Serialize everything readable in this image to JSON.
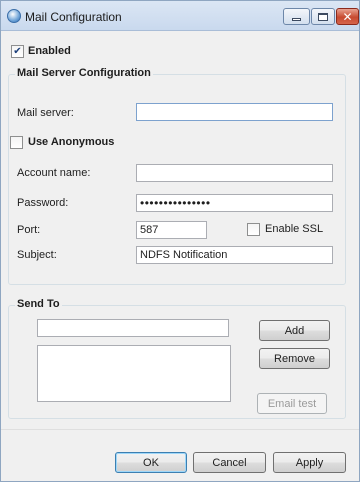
{
  "window": {
    "title": "Mail Configuration",
    "minimize_icon": "minimize-icon",
    "maximize_icon": "maximize-icon",
    "close_icon": "close-icon",
    "close_glyph": "✕"
  },
  "enabled": {
    "label": "Enabled",
    "checked": true,
    "check_glyph": "✔"
  },
  "server_group": {
    "title": "Mail Server Configuration",
    "mail_server": {
      "label": "Mail server:",
      "value": ""
    },
    "use_anonymous": {
      "label": "Use Anonymous",
      "checked": false
    },
    "account_name": {
      "label": "Account name:",
      "value": ""
    },
    "password": {
      "label": "Password:",
      "value": "•••••••••••••••"
    },
    "port": {
      "label": "Port:",
      "value": "587"
    },
    "enable_ssl": {
      "label": "Enable SSL",
      "checked": false
    },
    "subject": {
      "label": "Subject:",
      "value": "NDFS Notification"
    }
  },
  "send_to_group": {
    "title": "Send To",
    "address_value": "",
    "add_label": "Add",
    "remove_label": "Remove",
    "email_test_label": "Email test",
    "recipients": []
  },
  "footer": {
    "ok_label": "OK",
    "cancel_label": "Cancel",
    "apply_label": "Apply"
  },
  "colors": {
    "accent": "#3c7fb1",
    "titlebar": "#c9d9ee",
    "close_button": "#c74a30"
  }
}
